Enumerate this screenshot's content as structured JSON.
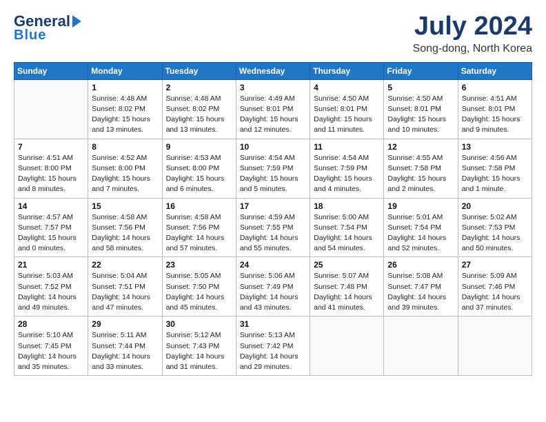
{
  "header": {
    "logo_line1": "General",
    "logo_line2": "Blue",
    "month_title": "July 2024",
    "subtitle": "Song-dong, North Korea"
  },
  "days_of_week": [
    "Sunday",
    "Monday",
    "Tuesday",
    "Wednesday",
    "Thursday",
    "Friday",
    "Saturday"
  ],
  "weeks": [
    [
      {
        "date": "",
        "info": ""
      },
      {
        "date": "1",
        "info": "Sunrise: 4:48 AM\nSunset: 8:02 PM\nDaylight: 15 hours\nand 13 minutes."
      },
      {
        "date": "2",
        "info": "Sunrise: 4:48 AM\nSunset: 8:02 PM\nDaylight: 15 hours\nand 13 minutes."
      },
      {
        "date": "3",
        "info": "Sunrise: 4:49 AM\nSunset: 8:01 PM\nDaylight: 15 hours\nand 12 minutes."
      },
      {
        "date": "4",
        "info": "Sunrise: 4:50 AM\nSunset: 8:01 PM\nDaylight: 15 hours\nand 11 minutes."
      },
      {
        "date": "5",
        "info": "Sunrise: 4:50 AM\nSunset: 8:01 PM\nDaylight: 15 hours\nand 10 minutes."
      },
      {
        "date": "6",
        "info": "Sunrise: 4:51 AM\nSunset: 8:01 PM\nDaylight: 15 hours\nand 9 minutes."
      }
    ],
    [
      {
        "date": "7",
        "info": "Sunrise: 4:51 AM\nSunset: 8:00 PM\nDaylight: 15 hours\nand 8 minutes."
      },
      {
        "date": "8",
        "info": "Sunrise: 4:52 AM\nSunset: 8:00 PM\nDaylight: 15 hours\nand 7 minutes."
      },
      {
        "date": "9",
        "info": "Sunrise: 4:53 AM\nSunset: 8:00 PM\nDaylight: 15 hours\nand 6 minutes."
      },
      {
        "date": "10",
        "info": "Sunrise: 4:54 AM\nSunset: 7:59 PM\nDaylight: 15 hours\nand 5 minutes."
      },
      {
        "date": "11",
        "info": "Sunrise: 4:54 AM\nSunset: 7:59 PM\nDaylight: 15 hours\nand 4 minutes."
      },
      {
        "date": "12",
        "info": "Sunrise: 4:55 AM\nSunset: 7:58 PM\nDaylight: 15 hours\nand 2 minutes."
      },
      {
        "date": "13",
        "info": "Sunrise: 4:56 AM\nSunset: 7:58 PM\nDaylight: 15 hours\nand 1 minute."
      }
    ],
    [
      {
        "date": "14",
        "info": "Sunrise: 4:57 AM\nSunset: 7:57 PM\nDaylight: 15 hours\nand 0 minutes."
      },
      {
        "date": "15",
        "info": "Sunrise: 4:58 AM\nSunset: 7:56 PM\nDaylight: 14 hours\nand 58 minutes."
      },
      {
        "date": "16",
        "info": "Sunrise: 4:58 AM\nSunset: 7:56 PM\nDaylight: 14 hours\nand 57 minutes."
      },
      {
        "date": "17",
        "info": "Sunrise: 4:59 AM\nSunset: 7:55 PM\nDaylight: 14 hours\nand 55 minutes."
      },
      {
        "date": "18",
        "info": "Sunrise: 5:00 AM\nSunset: 7:54 PM\nDaylight: 14 hours\nand 54 minutes."
      },
      {
        "date": "19",
        "info": "Sunrise: 5:01 AM\nSunset: 7:54 PM\nDaylight: 14 hours\nand 52 minutes."
      },
      {
        "date": "20",
        "info": "Sunrise: 5:02 AM\nSunset: 7:53 PM\nDaylight: 14 hours\nand 50 minutes."
      }
    ],
    [
      {
        "date": "21",
        "info": "Sunrise: 5:03 AM\nSunset: 7:52 PM\nDaylight: 14 hours\nand 49 minutes."
      },
      {
        "date": "22",
        "info": "Sunrise: 5:04 AM\nSunset: 7:51 PM\nDaylight: 14 hours\nand 47 minutes."
      },
      {
        "date": "23",
        "info": "Sunrise: 5:05 AM\nSunset: 7:50 PM\nDaylight: 14 hours\nand 45 minutes."
      },
      {
        "date": "24",
        "info": "Sunrise: 5:06 AM\nSunset: 7:49 PM\nDaylight: 14 hours\nand 43 minutes."
      },
      {
        "date": "25",
        "info": "Sunrise: 5:07 AM\nSunset: 7:48 PM\nDaylight: 14 hours\nand 41 minutes."
      },
      {
        "date": "26",
        "info": "Sunrise: 5:08 AM\nSunset: 7:47 PM\nDaylight: 14 hours\nand 39 minutes."
      },
      {
        "date": "27",
        "info": "Sunrise: 5:09 AM\nSunset: 7:46 PM\nDaylight: 14 hours\nand 37 minutes."
      }
    ],
    [
      {
        "date": "28",
        "info": "Sunrise: 5:10 AM\nSunset: 7:45 PM\nDaylight: 14 hours\nand 35 minutes."
      },
      {
        "date": "29",
        "info": "Sunrise: 5:11 AM\nSunset: 7:44 PM\nDaylight: 14 hours\nand 33 minutes."
      },
      {
        "date": "30",
        "info": "Sunrise: 5:12 AM\nSunset: 7:43 PM\nDaylight: 14 hours\nand 31 minutes."
      },
      {
        "date": "31",
        "info": "Sunrise: 5:13 AM\nSunset: 7:42 PM\nDaylight: 14 hours\nand 29 minutes."
      },
      {
        "date": "",
        "info": ""
      },
      {
        "date": "",
        "info": ""
      },
      {
        "date": "",
        "info": ""
      }
    ]
  ]
}
